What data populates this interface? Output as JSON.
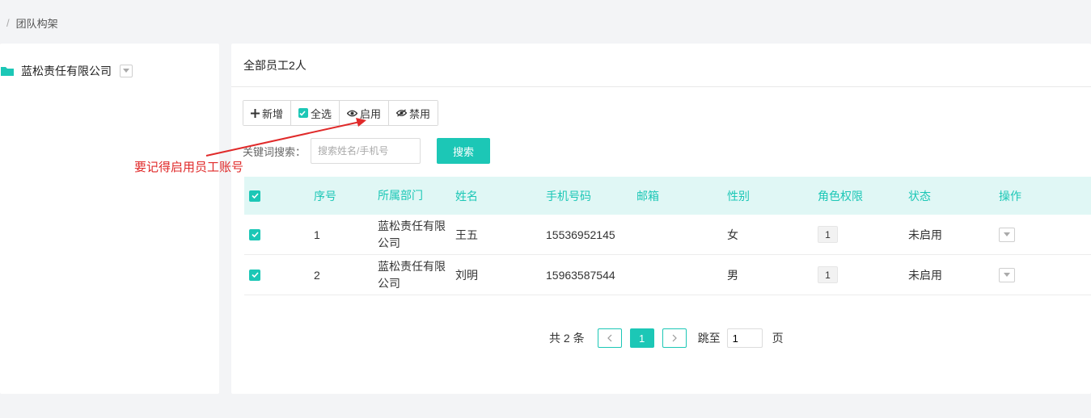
{
  "breadcrumb": {
    "separator": "/",
    "current": "团队构架"
  },
  "tree": {
    "root_label": "蓝松责任有限公司"
  },
  "main": {
    "header_title": "全部员工2人"
  },
  "toolbar": {
    "add_label": "新增",
    "select_all_label": "全选",
    "enable_label": "启用",
    "disable_label": "禁用"
  },
  "search": {
    "label": "关键词搜索：",
    "placeholder": "搜索姓名/手机号",
    "button_label": "搜索"
  },
  "table": {
    "headers": {
      "seq": "序号",
      "dept": "所属部门",
      "name": "姓名",
      "phone": "手机号码",
      "email": "邮箱",
      "gender": "性别",
      "role": "角色权限",
      "status": "状态",
      "ops": "操作"
    },
    "rows": [
      {
        "checked": true,
        "seq": "1",
        "dept": "蓝松责任有限公司",
        "name": "王五",
        "phone": "15536952145",
        "email": "",
        "gender": "女",
        "role": "1",
        "status": "未启用"
      },
      {
        "checked": true,
        "seq": "2",
        "dept": "蓝松责任有限公司",
        "name": "刘明",
        "phone": "15963587544",
        "email": "",
        "gender": "男",
        "role": "1",
        "status": "未启用"
      }
    ]
  },
  "pagination": {
    "total_text": "共 2 条",
    "current_page": "1",
    "jump_label": "跳至",
    "jump_value": "1",
    "page_suffix": "页"
  },
  "annotation": {
    "text": "要记得启用员工账号",
    "color": "#e02a2a"
  },
  "colors": {
    "accent": "#1cc7b6",
    "header_bg": "#e0f7f5"
  }
}
